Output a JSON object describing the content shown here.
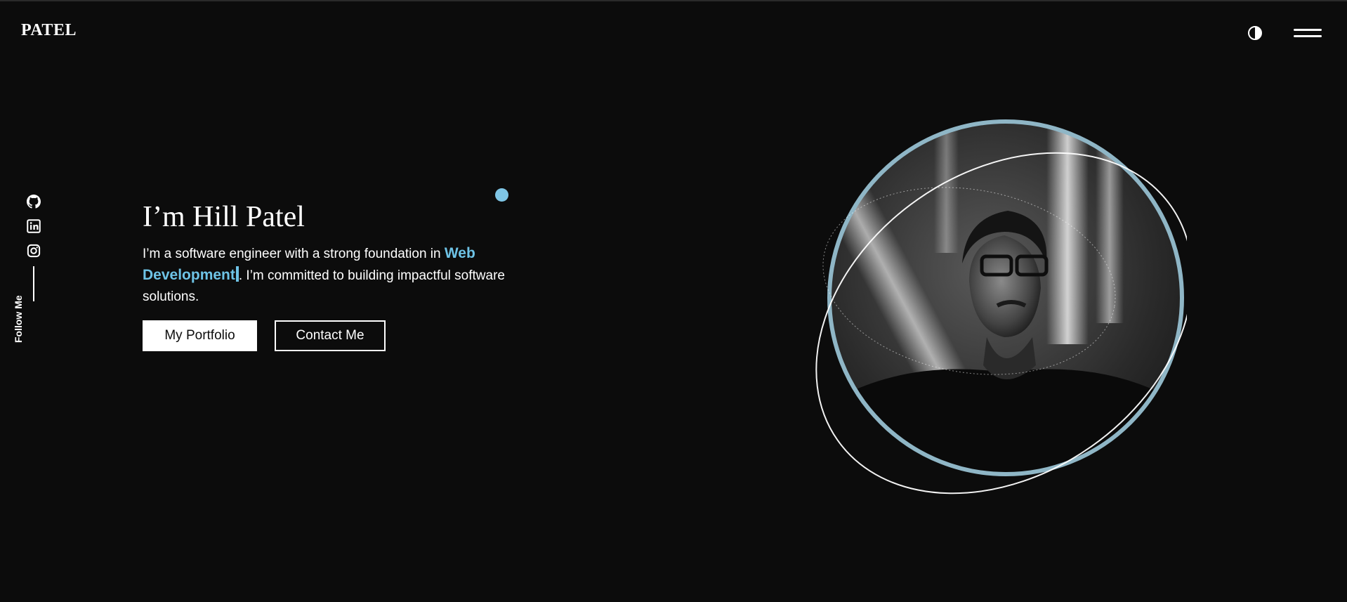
{
  "header": {
    "logo": "PATEL",
    "theme_toggle_icon": "half-circle-contrast-icon",
    "menu_icon": "hamburger-menu-icon"
  },
  "social": {
    "items": [
      {
        "name": "github-icon"
      },
      {
        "name": "linkedin-icon"
      },
      {
        "name": "instagram-icon"
      }
    ],
    "follow_label": "Follow Me"
  },
  "hero": {
    "title": "I’m Hill Patel",
    "desc_before": "I’m a software engineer with a strong foundation in ",
    "highlight": "Web Development",
    "desc_after": ". I’m committed to building impactful software solutions.",
    "primary_button": "My Portfolio",
    "secondary_button": "Contact Me"
  },
  "colors": {
    "background": "#0c0c0c",
    "accent": "#6ec3e6",
    "ring": "#8fb6c6"
  }
}
